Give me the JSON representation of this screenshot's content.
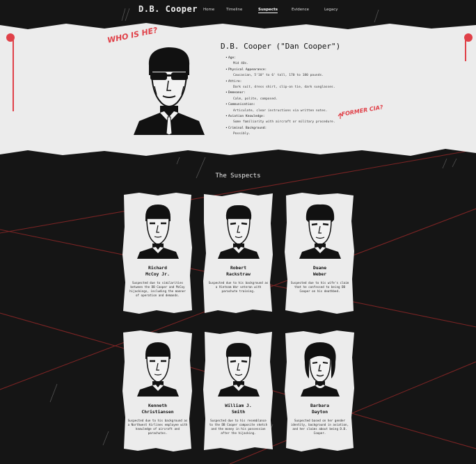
{
  "nav": {
    "brand": "D.B. Cooper",
    "links": [
      "Home",
      "Timeline",
      "Suspects",
      "Evidence",
      "Legacy"
    ],
    "active": "Suspects"
  },
  "profile": {
    "annotation_who": "WHO IS HE?",
    "annotation_cia": "FORMER CIA?",
    "title": "D.B. Cooper (\"Dan Cooper\")",
    "items": [
      {
        "label": "Age:",
        "value": "Mid 40s."
      },
      {
        "label": "Physical Appearance:",
        "value": "Caucasian, 5'10\" to 6' tall, 170 to 180 pounds."
      },
      {
        "label": "Attire:",
        "value": "Dark suit, dress shirt, clip-on tie, dark sunglasses."
      },
      {
        "label": "Demeanor:",
        "value": "Calm, polite, composed."
      },
      {
        "label": "Communication:",
        "value": "Articulate, clear instructions via written notes."
      },
      {
        "label": "Aviation Knowledge:",
        "value": "Some familiarity with aircraft or military procedure."
      },
      {
        "label": "Criminal Background:",
        "value": "Possibly."
      }
    ]
  },
  "suspects_title": "The Suspects",
  "suspects": [
    {
      "name1": "Richard",
      "name2": "McCoy Jr.",
      "desc": "Suspected due to similarities between the DB Cooper and McCoy hijackings, including the manner of operation and demands."
    },
    {
      "name1": "Robert",
      "name2": "Rackstraw",
      "desc": "Suspected due to his background as a Vietnam War veteran with parachute training."
    },
    {
      "name1": "Duane",
      "name2": "Weber",
      "desc": "Suspected due to his wife's claim that he confessed to being DB Cooper on his deathbed."
    },
    {
      "name1": "Kenneth",
      "name2": "Christiansen",
      "desc": "Suspected due to his background as a Northwest Airlines employee with knowledge of aircraft and parachutes."
    },
    {
      "name1": "William J.",
      "name2": "Smith",
      "desc": "Suspected due to his resemblance to the DB Cooper composite sketch and the money in his possession after the hijacking."
    },
    {
      "name1": "Barbara",
      "name2": "Dayton",
      "desc": "Suspected based on her gender identity, background in aviation, and her claims about being D.B. Cooper."
    }
  ],
  "colors": {
    "accent": "#e04048",
    "background": "#151515",
    "paper": "#ececec"
  }
}
